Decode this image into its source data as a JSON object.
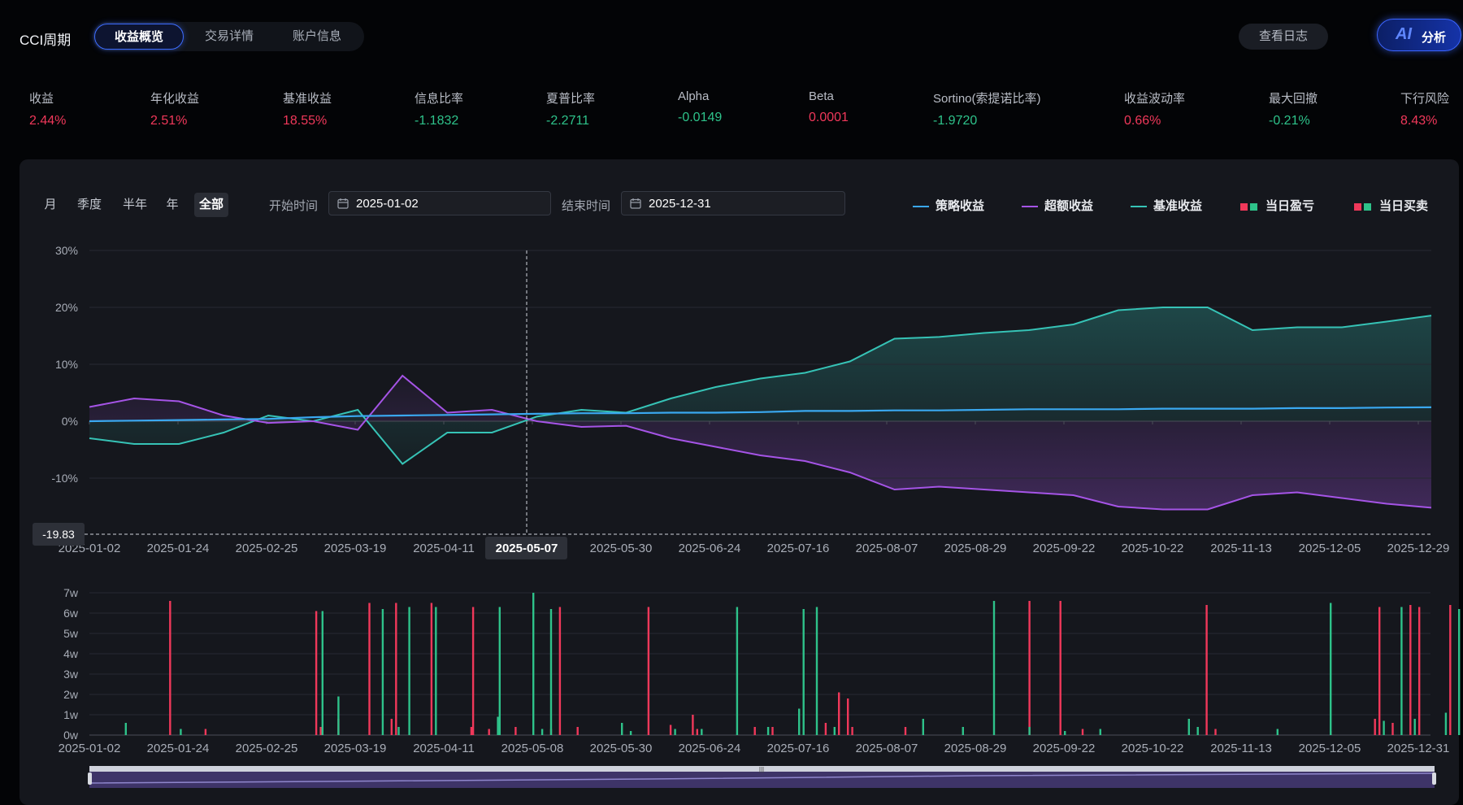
{
  "header": {
    "title": "CCI周期",
    "tabs": [
      {
        "label": "收益概览",
        "active": true
      },
      {
        "label": "交易详情",
        "active": false
      },
      {
        "label": "账户信息",
        "active": false
      }
    ],
    "log_button": "查看日志",
    "ai_button": {
      "ai": "AI",
      "label": "分析"
    }
  },
  "metrics": [
    {
      "label": "收益",
      "value": "2.44%",
      "color": "#f0385a"
    },
    {
      "label": "年化收益",
      "value": "2.51%",
      "color": "#f0385a"
    },
    {
      "label": "基准收益",
      "value": "18.55%",
      "color": "#f0385a"
    },
    {
      "label": "信息比率",
      "value": "-1.1832",
      "color": "#2ec28a"
    },
    {
      "label": "夏普比率",
      "value": "-2.2711",
      "color": "#2ec28a"
    },
    {
      "label": "Alpha",
      "value": "-0.0149",
      "color": "#2ec28a"
    },
    {
      "label": "Beta",
      "value": "0.0001",
      "color": "#f0385a"
    },
    {
      "label": "Sortino(索提诺比率)",
      "value": "-1.9720",
      "color": "#2ec28a"
    },
    {
      "label": "收益波动率",
      "value": "0.66%",
      "color": "#f0385a"
    },
    {
      "label": "最大回撤",
      "value": "-0.21%",
      "color": "#2ec28a"
    },
    {
      "label": "下行风险",
      "value": "8.43%",
      "color": "#f0385a"
    }
  ],
  "filters": {
    "periods": [
      {
        "label": "月",
        "active": false
      },
      {
        "label": "季度",
        "active": false
      },
      {
        "label": "半年",
        "active": false
      },
      {
        "label": "年",
        "active": false
      },
      {
        "label": "全部",
        "active": true
      }
    ],
    "start_label": "开始时间",
    "start_value": "2025-01-02",
    "end_label": "结束时间",
    "end_value": "2025-12-31"
  },
  "legend": [
    {
      "label": "策略收益",
      "kind": "line",
      "colors": [
        "#3aa8f0"
      ]
    },
    {
      "label": "超额收益",
      "kind": "line",
      "colors": [
        "#a554e6"
      ]
    },
    {
      "label": "基准收益",
      "kind": "line",
      "colors": [
        "#36c3b6"
      ]
    },
    {
      "label": "当日盈亏",
      "kind": "squares",
      "colors": [
        "#f0385a",
        "#2ec28a"
      ]
    },
    {
      "label": "当日买卖",
      "kind": "squares",
      "colors": [
        "#f0385a",
        "#2ec28a"
      ]
    }
  ],
  "crosshair": {
    "date": "2025-05-07",
    "y_value": "-19.83",
    "x_date": "2025-05-07"
  },
  "chart_data": [
    {
      "type": "line",
      "x_labels": [
        "2025-01-02",
        "2025-01-24",
        "2025-02-25",
        "2025-03-19",
        "2025-04-11",
        "2025-05-07",
        "2025-05-30",
        "2025-06-24",
        "2025-07-16",
        "2025-08-07",
        "2025-08-29",
        "2025-09-22",
        "2025-10-22",
        "2025-11-13",
        "2025-12-05",
        "2025-12-29"
      ],
      "y_ticks": [
        "30%",
        "20%",
        "10%",
        "0%",
        "-10%"
      ],
      "ylim": [
        -20,
        30
      ],
      "series": [
        {
          "name": "策略收益",
          "color": "#3aa8f0",
          "values": [
            0.0,
            0.1,
            0.2,
            0.3,
            0.4,
            0.7,
            0.9,
            1.0,
            1.1,
            1.2,
            1.3,
            1.4,
            1.4,
            1.5,
            1.5,
            1.6,
            1.8,
            1.8,
            1.9,
            1.9,
            2.0,
            2.1,
            2.1,
            2.1,
            2.2,
            2.2,
            2.2,
            2.3,
            2.3,
            2.4,
            2.44
          ]
        },
        {
          "name": "超额收益",
          "color": "#a554e6",
          "values": [
            2.5,
            4.0,
            3.5,
            1.0,
            -0.3,
            0.0,
            -1.5,
            8.0,
            1.5,
            2.0,
            0.0,
            -1.0,
            -0.8,
            -3.0,
            -4.5,
            -6.0,
            -7.0,
            -9.0,
            -12.0,
            -11.5,
            -12.0,
            -12.5,
            -13.0,
            -15.0,
            -15.5,
            -15.5,
            -13.0,
            -12.5,
            -13.5,
            -14.5,
            -15.2
          ]
        },
        {
          "name": "基准收益",
          "color": "#36c3b6",
          "values": [
            -3.0,
            -4.0,
            -4.0,
            -2.0,
            1.0,
            0.0,
            2.0,
            -7.5,
            -2.0,
            -2.0,
            0.8,
            2.0,
            1.5,
            4.0,
            6.0,
            7.5,
            8.5,
            10.5,
            14.5,
            14.8,
            15.5,
            16.0,
            17.0,
            19.5,
            20.0,
            20.0,
            16.0,
            16.5,
            16.5,
            17.5,
            18.55
          ]
        }
      ]
    },
    {
      "type": "bar",
      "x_labels": [
        "2025-01-02",
        "2025-01-24",
        "2025-02-25",
        "2025-03-19",
        "2025-04-11",
        "2025-05-08",
        "2025-05-30",
        "2025-06-24",
        "2025-07-16",
        "2025-08-07",
        "2025-08-29",
        "2025-09-22",
        "2025-10-22",
        "2025-11-13",
        "2025-12-05",
        "2025-12-31"
      ],
      "y_ticks": [
        "7w",
        "6w",
        "5w",
        "4w",
        "3w",
        "2w",
        "1w",
        "0w"
      ],
      "ylim": [
        0,
        7
      ],
      "unit": "w",
      "series": [
        {
          "name": "当日买卖-卖",
          "color": "#f0385a",
          "x": [
            0.9,
            1.3,
            2.55,
            2.6,
            2.8,
            3.15,
            3.4,
            3.45,
            3.85,
            4.3,
            4.32,
            4.5,
            4.8,
            5.2,
            5.3,
            5.5,
            6.3,
            6.55,
            6.8,
            6.85,
            7.5,
            7.7,
            8.3,
            8.45,
            8.55,
            8.6,
            9.2,
            10.6,
            10.95,
            11.2,
            12.6,
            12.7,
            14.0,
            14.5,
            14.55,
            14.7,
            14.9,
            15.0,
            15.35
          ],
          "values": [
            6.6,
            0.3,
            6.1,
            0.4,
            0.8,
            6.5,
            0.8,
            6.5,
            6.5,
            0.4,
            6.3,
            0.3,
            0.4,
            0.3,
            6.3,
            0.4,
            6.3,
            0.5,
            1.0,
            0.3,
            0.4,
            0.4,
            0.6,
            2.1,
            1.8,
            0.4,
            0.4,
            6.6,
            6.6,
            0.3,
            6.4,
            0.3,
            0.2,
            0.8,
            6.3,
            0.6,
            6.4,
            6.3,
            6.4
          ]
        },
        {
          "name": "当日买卖-买",
          "color": "#2ec28a",
          "x": [
            0.4,
            1.02,
            2.62,
            2.8,
            3.3,
            3.48,
            3.6,
            3.9,
            4.6,
            4.62,
            5.0,
            5.1,
            5.2,
            6.0,
            6.1,
            6.6,
            6.9,
            7.3,
            7.65,
            8.0,
            8.05,
            8.2,
            8.4,
            9.4,
            9.85,
            10.2,
            10.6,
            11.0,
            11.4,
            12.4,
            12.5,
            13.4,
            14.0,
            14.6,
            14.8,
            14.95,
            15.3,
            15.45
          ],
          "values": [
            0.6,
            0.3,
            6.1,
            1.9,
            6.2,
            0.4,
            6.3,
            6.3,
            0.9,
            6.3,
            7.0,
            0.3,
            6.2,
            0.6,
            0.2,
            0.3,
            0.3,
            6.3,
            0.4,
            1.3,
            6.2,
            6.3,
            0.4,
            0.8,
            0.4,
            6.6,
            0.4,
            0.2,
            0.3,
            0.8,
            0.4,
            0.3,
            6.5,
            0.7,
            6.3,
            0.8,
            1.1,
            6.2
          ]
        }
      ]
    }
  ]
}
